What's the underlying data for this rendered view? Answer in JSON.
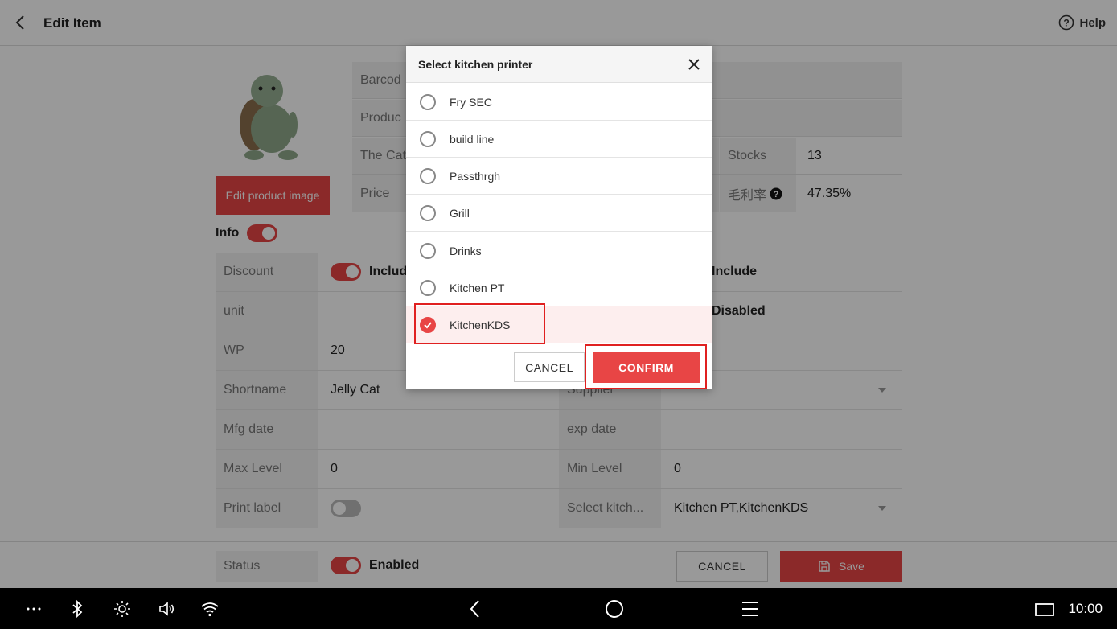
{
  "header": {
    "title": "Edit Item",
    "help_label": "Help"
  },
  "product": {
    "edit_image_label": "Edit product image"
  },
  "info_grid": {
    "barcode_label": "Barcod",
    "product_label": "Produc",
    "category_label": "The Cat",
    "price_label": "Price",
    "stocks_label": "Stocks",
    "stocks_value": "13",
    "margin_label": "毛利率",
    "margin_value": "47.35%"
  },
  "info_toggle": {
    "label": "Info",
    "on": true
  },
  "form": {
    "discount_label": "Discount",
    "discount_value": "Includ",
    "right_include_value": "Include",
    "unit_label": "unit",
    "right_disabled_value": "Disabled",
    "wp_label": "WP",
    "wp_value": "20",
    "shortname_label": "Shortname",
    "shortname_value": "Jelly Cat",
    "supplier_label": "Supplier",
    "mfg_label": "Mfg date",
    "exp_label": "exp date",
    "max_label": "Max Level",
    "max_value": "0",
    "min_label": "Min Level",
    "min_value": "0",
    "print_label": "Print label",
    "kitchen_label": "Select kitch...",
    "kitchen_value": "Kitchen PT,KitchenKDS"
  },
  "footer": {
    "status_label": "Status",
    "status_value": "Enabled",
    "cancel_label": "CANCEL",
    "save_label": "Save"
  },
  "dialog": {
    "title": "Select kitchen printer",
    "options": [
      {
        "label": "Fry SEC",
        "selected": false
      },
      {
        "label": "build line",
        "selected": false
      },
      {
        "label": "Passthrgh",
        "selected": false
      },
      {
        "label": "Grill",
        "selected": false
      },
      {
        "label": "Drinks",
        "selected": false
      },
      {
        "label": "Kitchen PT",
        "selected": false
      },
      {
        "label": "KitchenKDS",
        "selected": true
      }
    ],
    "cancel_label": "CANCEL",
    "confirm_label": "CONFIRM"
  },
  "system_bar": {
    "time": "10:00",
    "icons": [
      "more-icon",
      "bluetooth-icon",
      "brightness-icon",
      "volume-icon",
      "wifi-icon",
      "nav-back-icon",
      "nav-home-icon",
      "nav-menu-icon",
      "screen-icon"
    ]
  },
  "colors": {
    "accent": "#e84545",
    "highlight": "#e02020"
  }
}
